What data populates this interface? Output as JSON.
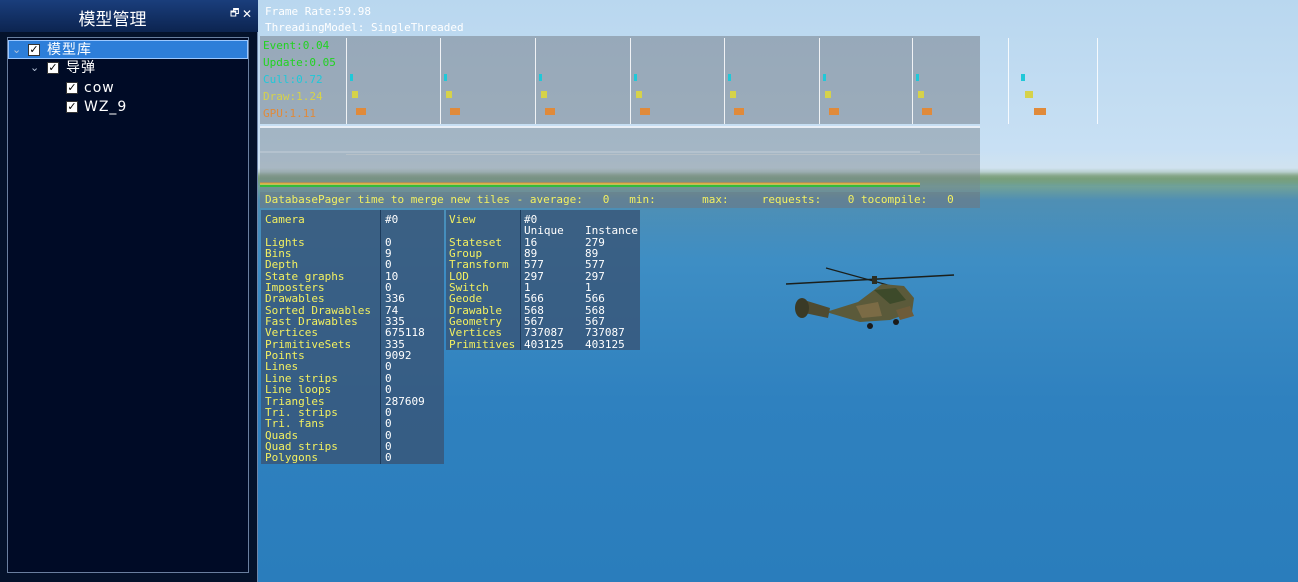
{
  "dock": {
    "title": "模型管理",
    "float_glyph": "🗗",
    "close_glyph": "✕",
    "tree": [
      {
        "label": "模型库",
        "depth": 0,
        "checked": true,
        "expanded": true,
        "selected": true
      },
      {
        "label": "导弹",
        "depth": 1,
        "checked": true,
        "expanded": true,
        "selected": false
      },
      {
        "label": "cow",
        "depth": 2,
        "checked": true,
        "expanded": false,
        "selected": false
      },
      {
        "label": "WZ_9",
        "depth": 2,
        "checked": true,
        "expanded": false,
        "selected": false
      }
    ]
  },
  "viewport": {
    "frame_rate": "Frame Rate:59.98",
    "threading": "ThreadingModel: SingleThreaded",
    "graph_labels": [
      {
        "text": "Event:0.04",
        "color": "#21d321"
      },
      {
        "text": "Update:0.05",
        "color": "#21d321"
      },
      {
        "text": "Cull:0.72",
        "color": "#20c8d8"
      },
      {
        "text": "Draw:1.24",
        "color": "#d6d24a"
      },
      {
        "text": "GPU:1.11",
        "color": "#e08a3a"
      }
    ],
    "pager_line": "DatabasePager time to merge new tiles - average:   0   min:       max:     requests:    0 tocompile:   0",
    "camera_labels": "Camera\n\nLights\nBins\nDepth\nState graphs\nImposters\nDrawables\nSorted Drawables\nFast Drawables\nVertices\nPrimitiveSets\nPoints\nLines\nLine strips\nLine loops\nTriangles\nTri. strips\nTri. fans\nQuads\nQuad strips\nPolygons",
    "camera_values": "#0\n\n0\n9\n0\n10\n0\n336\n74\n335\n675118\n335\n9092\n0\n0\n0\n287609\n0\n0\n0\n0\n0",
    "view_labels": "View\n\nStateset\nGroup\nTransform\nLOD\nSwitch\nGeode\nDrawable\nGeometry\nVertices\nPrimitives",
    "view_unique": "#0\nUnique\n16\n89\n577\n297\n1\n566\n568\n567\n737087\n403125",
    "view_instance": "\nInstance\n279\n89\n577\n297\n1\n566\n568\n567\n737087\n403125"
  }
}
